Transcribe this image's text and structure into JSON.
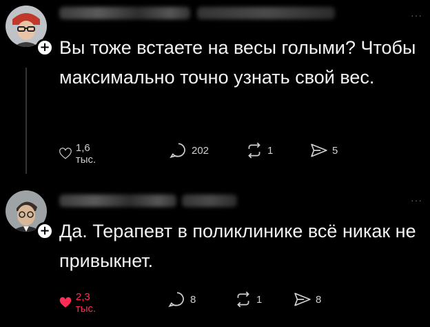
{
  "posts": [
    {
      "text": "Вы тоже встаете на весы голыми? Чтобы максимально точно узнать свой вес.",
      "likes": "1,6 тыс.",
      "replies": "202",
      "reposts": "1",
      "shares": "5",
      "liked": false,
      "more_label": "···"
    },
    {
      "text": "Да. Терапевт в поликлинике всё никак не привыкнет.",
      "likes": "2,3 тыс.",
      "replies": "8",
      "reposts": "1",
      "shares": "8",
      "liked": true,
      "more_label": "···"
    }
  ],
  "colors": {
    "background": "#000000",
    "text": "#f2f2f2",
    "like_active": "#ff2d55",
    "icon": "#cfcfcf"
  },
  "icons": [
    "plus-follow-icon",
    "heart-icon",
    "reply-icon",
    "repost-icon",
    "share-icon",
    "more-icon"
  ]
}
